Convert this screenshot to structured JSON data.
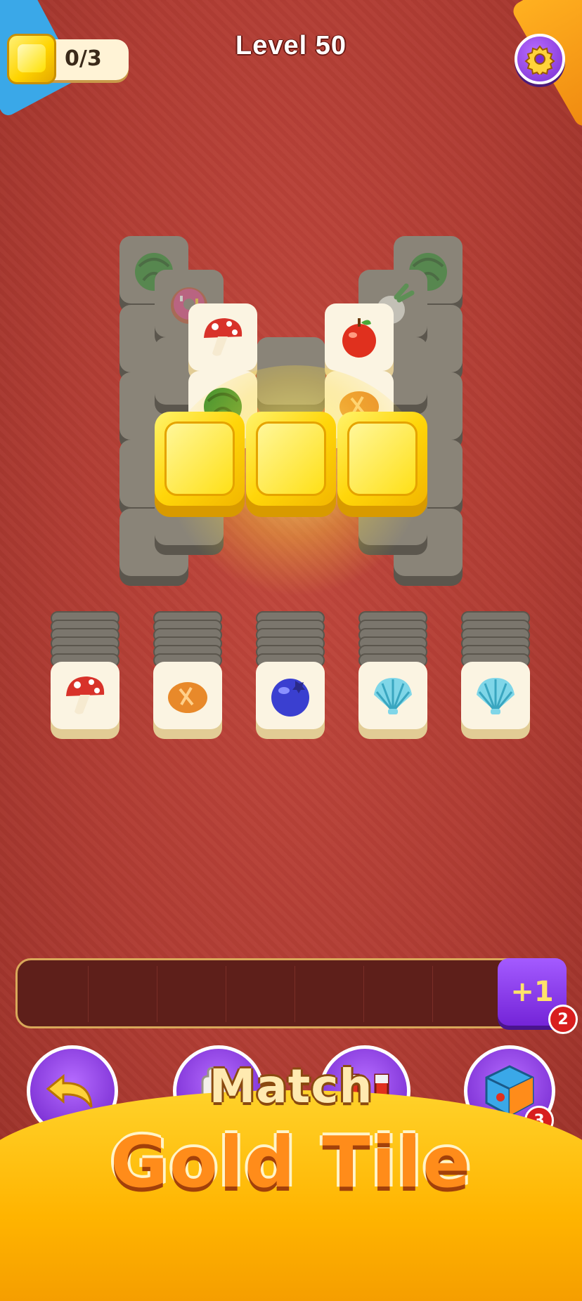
{
  "header": {
    "gold_counter": "0/3",
    "level_title": "Level 50",
    "settings_icon": "gear-icon"
  },
  "board": {
    "tiles": [
      {
        "icon": "watermelon-icon",
        "state": "dim"
      },
      {
        "icon": "donut-icon",
        "state": "dim"
      },
      {
        "icon": "mushroom-icon",
        "state": "active"
      },
      {
        "icon": "watermelon-icon",
        "state": "dim"
      },
      {
        "icon": "radish-icon",
        "state": "dim"
      },
      {
        "icon": "apple-icon",
        "state": "active"
      },
      {
        "icon": "watermelon-icon",
        "state": "active"
      },
      {
        "icon": "bread-icon",
        "state": "active"
      }
    ],
    "gold_tiles": 3
  },
  "stacks": [
    {
      "icon": "mushroom-icon"
    },
    {
      "icon": "bread-icon"
    },
    {
      "icon": "blueberry-icon"
    },
    {
      "icon": "seashell-icon"
    },
    {
      "icon": "seashell-icon"
    }
  ],
  "tray": {
    "slots": 7,
    "extra_slot_label": "+1",
    "extra_slot_count": "2"
  },
  "powerups": [
    {
      "name": "undo",
      "icon": "undo-arrow-icon"
    },
    {
      "name": "magic",
      "icon": "glove-icon"
    },
    {
      "name": "magnet",
      "icon": "magnet-icon"
    },
    {
      "name": "shuffle",
      "icon": "dice-icon",
      "count": "3"
    }
  ],
  "banner": {
    "line1": "Match",
    "line2": "Gold Tile"
  },
  "colors": {
    "table": "#b03c33",
    "gold": "#ffd60a",
    "purple": "#7a2fd0",
    "banner": "#ffb400"
  }
}
